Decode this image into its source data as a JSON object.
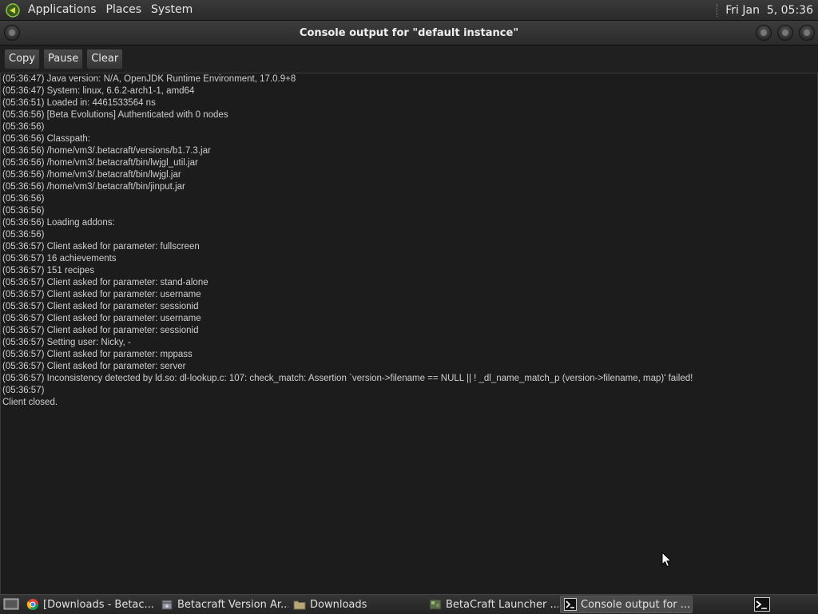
{
  "top_panel": {
    "menus": [
      "Applications",
      "Places",
      "System"
    ],
    "clock": "Fri Jan  5, 05:36"
  },
  "window": {
    "title": "Console output for \"default instance\""
  },
  "toolbar": {
    "copy_label": "Copy",
    "pause_label": "Pause",
    "clear_label": "Clear"
  },
  "console": {
    "lines": [
      "(05:36:47) Java version: N/A, OpenJDK Runtime Environment, 17.0.9+8",
      "(05:36:47) System: linux, 6.6.2-arch1-1, amd64",
      "(05:36:51) Loaded in: 4461533564 ns",
      "(05:36:56) [Beta Evolutions] Authenticated with 0 nodes",
      "(05:36:56)",
      "(05:36:56) Classpath:",
      "(05:36:56) /home/vm3/.betacraft/versions/b1.7.3.jar",
      "(05:36:56) /home/vm3/.betacraft/bin/lwjgl_util.jar",
      "(05:36:56) /home/vm3/.betacraft/bin/lwjgl.jar",
      "(05:36:56) /home/vm3/.betacraft/bin/jinput.jar",
      "(05:36:56)",
      "(05:36:56)",
      "(05:36:56) Loading addons:",
      "(05:36:56)",
      "(05:36:57) Client asked for parameter: fullscreen",
      "(05:36:57) 16 achievements",
      "(05:36:57) 151 recipes",
      "(05:36:57) Client asked for parameter: stand-alone",
      "(05:36:57) Client asked for parameter: username",
      "(05:36:57) Client asked for parameter: sessionid",
      "(05:36:57) Client asked for parameter: username",
      "(05:36:57) Client asked for parameter: sessionid",
      "(05:36:57) Setting user: Nicky, -",
      "(05:36:57) Client asked for parameter: mppass",
      "(05:36:57) Client asked for parameter: server",
      "(05:36:57) Inconsistency detected by ld.so: dl-lookup.c: 107: check_match: Assertion `version->filename == NULL || ! _dl_name_match_p (version->filename, map)' failed!",
      "(05:36:57)",
      "Client closed."
    ]
  },
  "taskbar": {
    "tasks": [
      {
        "label": "[Downloads - Betac...",
        "icon": "chrome-icon"
      },
      {
        "label": "Betacraft Version Ar...",
        "icon": "package-icon"
      },
      {
        "label": "Downloads",
        "icon": "folder-icon"
      },
      {
        "label": "BetaCraft Launcher ...",
        "icon": "betacraft-icon"
      },
      {
        "label": "Console output for ...",
        "icon": "terminal-icon"
      }
    ]
  },
  "colors": {
    "background": "#1c1c1c",
    "panel": "#2a2a2a",
    "text": "#cfcfcf"
  }
}
